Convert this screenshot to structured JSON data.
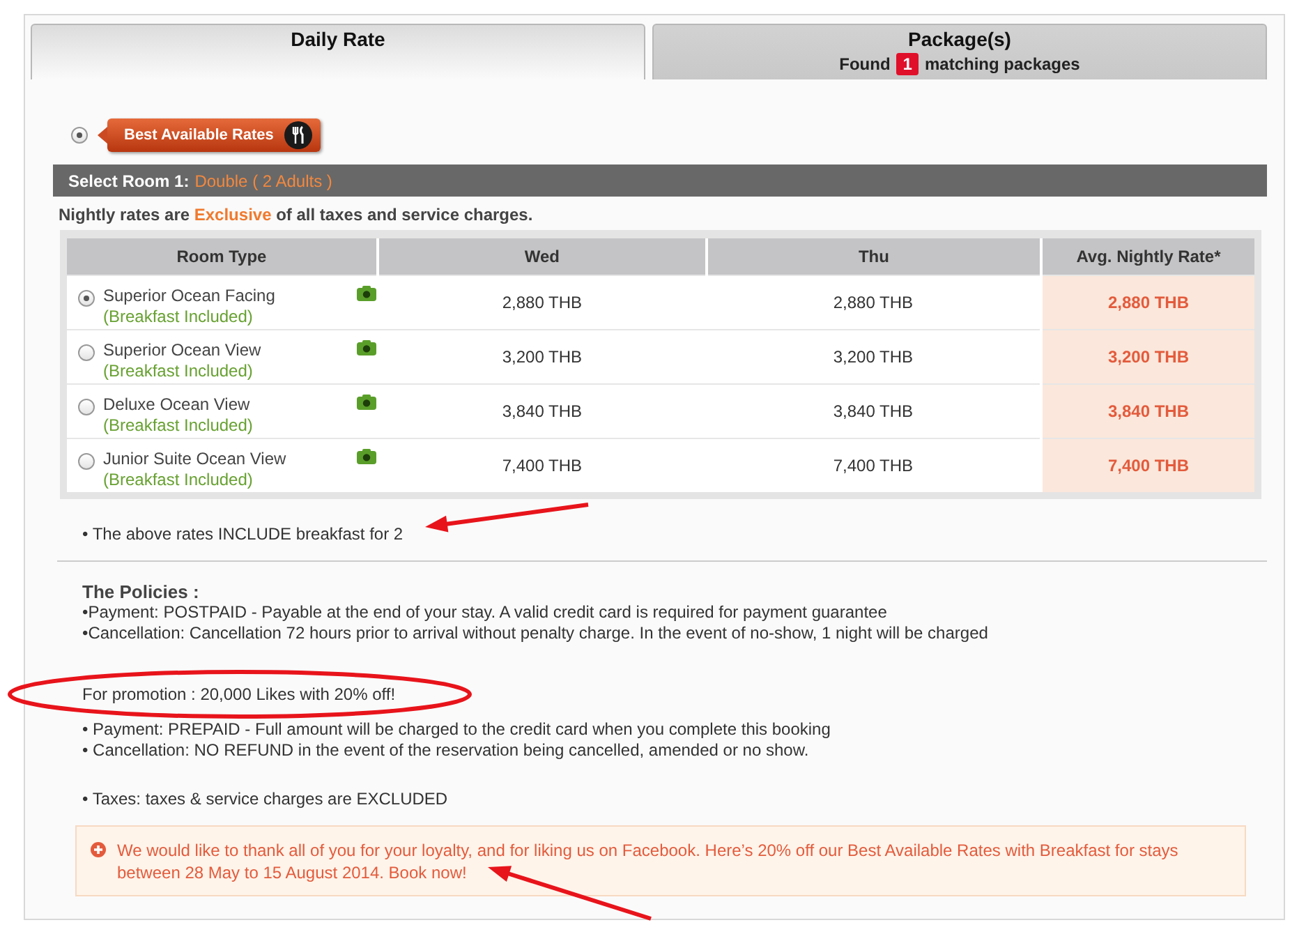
{
  "tabs": [
    {
      "label": "Daily Rate",
      "selected": true
    },
    {
      "label": "Package(s)",
      "selected": false,
      "found": "Found",
      "count": "1",
      "found_suffix": "matching packages"
    }
  ],
  "rate_plan": {
    "label": "Best Available Rates",
    "selected": true
  },
  "room_bar": {
    "label": "Select Room 1:",
    "value": "Double ( 2 Adults )"
  },
  "tax_note": {
    "before": "Nightly rates are",
    "highlight": "Exclusive",
    "after": "of all taxes and service charges."
  },
  "table": {
    "columns": [
      "Room Type",
      "Wed",
      "Thu",
      "Avg. Nightly Rate*"
    ],
    "rows": [
      {
        "selected": true,
        "name": "Superior Ocean Facing",
        "note": "(Breakfast Included)",
        "wed": "2,880 THB",
        "thu": "2,880 THB",
        "avg": "2,880 THB"
      },
      {
        "selected": false,
        "name": "Superior Ocean View",
        "note": "(Breakfast Included)",
        "wed": "3,200 THB",
        "thu": "3,200 THB",
        "avg": "3,200 THB"
      },
      {
        "selected": false,
        "name": "Deluxe Ocean View",
        "note": "(Breakfast Included)",
        "wed": "3,840 THB",
        "thu": "3,840 THB",
        "avg": "3,840 THB"
      },
      {
        "selected": false,
        "name": "Junior Suite Ocean View",
        "note": "(Breakfast Included)",
        "wed": "7,400 THB",
        "thu": "7,400 THB",
        "avg": "7,400 THB"
      }
    ]
  },
  "breakfast_note": "• The above rates INCLUDE breakfast for 2",
  "policies": {
    "title": "The Policies :",
    "lines": [
      "•Payment: POSTPAID - Payable at the end of your stay. A valid credit card is required for payment guarantee",
      "•Cancellation: Cancellation 72 hours prior to arrival without penalty charge. In the event of no-show, 1 night will be charged"
    ],
    "promotion_title": "For promotion : 20,000 Likes with 20% off!",
    "promotion_lines": [
      "• Payment: PREPAID - Full amount will be charged to the credit card when you complete this booking",
      "• Cancellation: NO REFUND in the event of the reservation being cancelled, amended or no show."
    ],
    "taxes": "• Taxes: taxes & service charges are EXCLUDED"
  },
  "promo_message": "We would like to thank all of you for your loyalty, and for liking us on Facebook. Here’s 20% off our Best Available Rates with Breakfast for stays between 28 May to 15 August 2014. Book now!",
  "annotations": [
    {
      "kind": "arrow"
    },
    {
      "kind": "ellipse"
    },
    {
      "kind": "arrow"
    }
  ]
}
